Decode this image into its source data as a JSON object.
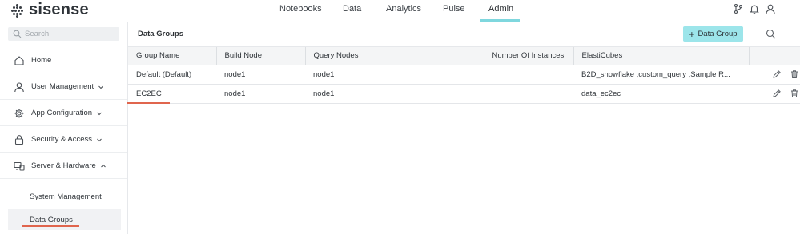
{
  "app": {
    "brand": "sisense",
    "accent": "#9ce5ea",
    "nav_underline_color": "#7fd7de",
    "marker_color": "#e0654d"
  },
  "topnav": {
    "tabs": [
      {
        "label": "Notebooks"
      },
      {
        "label": "Data"
      },
      {
        "label": "Analytics"
      },
      {
        "label": "Pulse"
      },
      {
        "label": "Admin",
        "active": true
      }
    ],
    "icons": [
      "branch-icon",
      "bell-icon",
      "user-icon"
    ]
  },
  "sidebar": {
    "search_placeholder": "Search",
    "items": [
      {
        "label": "Home",
        "icon": "home-icon"
      },
      {
        "label": "User Management",
        "icon": "user-icon",
        "chevron": "down"
      },
      {
        "label": "App Configuration",
        "icon": "gear-icon",
        "chevron": "down"
      },
      {
        "label": "Security & Access",
        "icon": "lock-icon",
        "chevron": "down"
      },
      {
        "label": "Server & Hardware",
        "icon": "monitor-icon",
        "chevron": "up"
      }
    ],
    "subitems": [
      {
        "label": "System Management"
      },
      {
        "label": "Data Groups",
        "active": true
      }
    ]
  },
  "main": {
    "title": "Data Groups",
    "add_button": "Data Group",
    "table": {
      "columns": [
        "Group Name",
        "Build Node",
        "Query Nodes",
        "Number Of Instances",
        "ElastiCubes"
      ],
      "rows": [
        {
          "group_name": "Default (Default)",
          "build_node": "node1",
          "query_nodes": "node1",
          "instances": "",
          "elasticubes": "B2D_snowflake ,custom_query ,Sample R..."
        },
        {
          "group_name": "EC2EC",
          "build_node": "node1",
          "query_nodes": "node1",
          "instances": "",
          "elasticubes": "data_ec2ec"
        }
      ]
    }
  }
}
